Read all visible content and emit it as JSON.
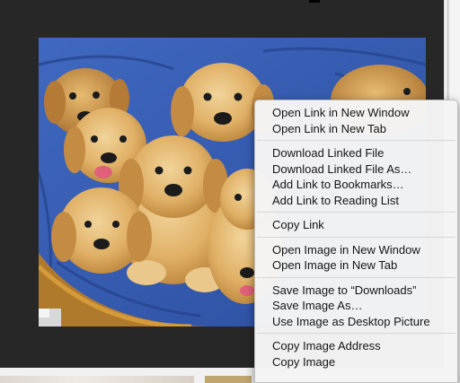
{
  "context_menu": {
    "groups": [
      [
        "Open Link in New Window",
        "Open Link in New Tab"
      ],
      [
        "Download Linked File",
        "Download Linked File As…",
        "Add Link to Bookmarks…",
        "Add Link to Reading List"
      ],
      [
        "Copy Link"
      ],
      [
        "Open Image in New Window",
        "Open Image in New Tab"
      ],
      [
        "Save Image to “Downloads”",
        "Save Image As…",
        "Use Image as Desktop Picture"
      ],
      [
        "Copy Image Address",
        "Copy Image"
      ]
    ]
  },
  "colors": {
    "page_background": "#272727",
    "chair_blue": "#3e63b7",
    "puppy_gold": "#e3b467",
    "menu_background": "#f4f4f4"
  }
}
